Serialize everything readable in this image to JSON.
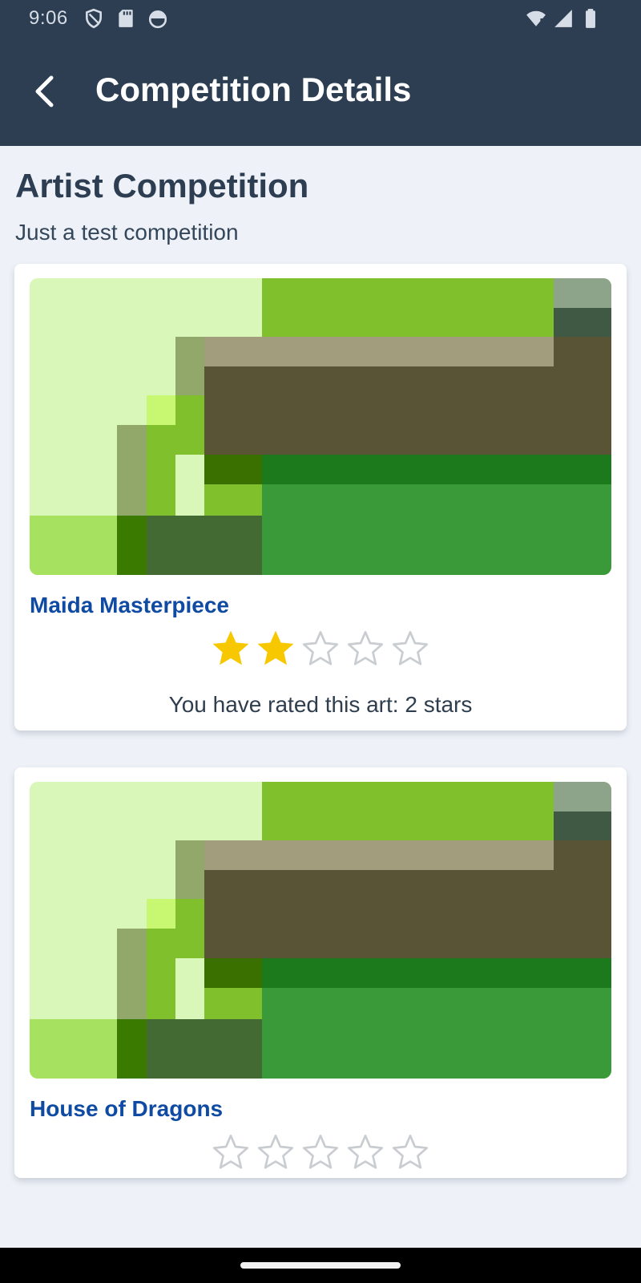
{
  "status_bar": {
    "time": "9:06",
    "icons_left": [
      "shield-icon",
      "sd-card-icon",
      "android-face-icon"
    ],
    "icons_right": [
      "wifi-icon",
      "cellular-signal-icon",
      "battery-icon"
    ]
  },
  "app_bar": {
    "back_icon": "chevron-left-icon",
    "title": "Competition Details",
    "color": "#2d3e52"
  },
  "competition": {
    "title": "Artist Competition",
    "description": "Just a test competition"
  },
  "artworks": [
    {
      "title": "Maida Masterpiece",
      "rating": 2,
      "max_rating": 5,
      "rating_text": "You have rated this art: 2 stars"
    },
    {
      "title": "House of Dragons",
      "rating": 0,
      "max_rating": 5
    }
  ],
  "colors": {
    "star_filled": "#f7c800",
    "star_empty_outline": "#c9ccd0",
    "artwork_title": "#0f4aa3",
    "background": "#eef2f8"
  }
}
